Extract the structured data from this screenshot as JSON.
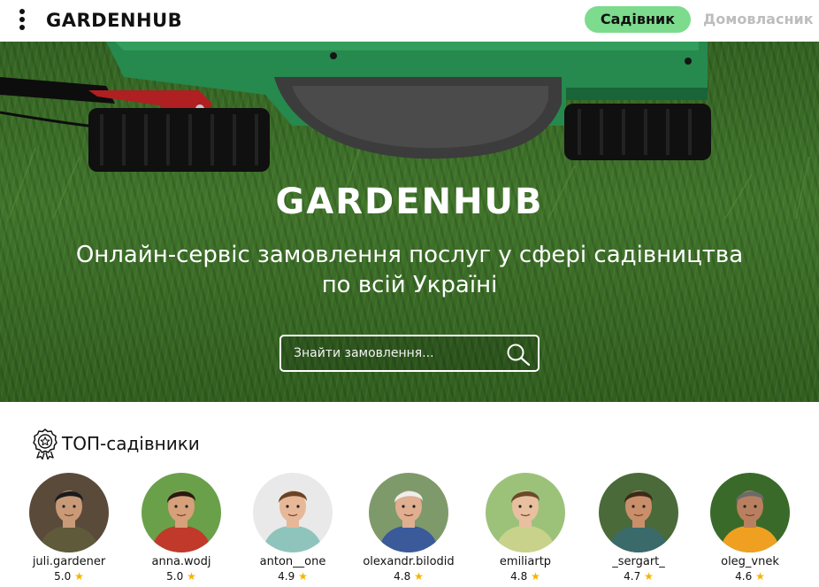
{
  "header": {
    "logo": "GARDENHUB",
    "role_active": "Садівник",
    "role_inactive": "Домовласник"
  },
  "hero": {
    "title": "GARDENHUB",
    "subtitle_line1": "Онлайн-сервіс замовлення послуг у сфері садівництва",
    "subtitle_line2": "по всій Україні",
    "search_placeholder": "Знайти замовлення..."
  },
  "top": {
    "title": "ТОП-садівники",
    "gardeners": [
      {
        "name": "juli.gardener",
        "rating": "5.0",
        "skin": "#c99a78",
        "hair": "#1b1b1b",
        "bg": "#5a4a3a",
        "shirt": "#5e5a3a"
      },
      {
        "name": "anna.wodj",
        "rating": "5.0",
        "skin": "#d6a07a",
        "hair": "#2a1a10",
        "bg": "#6aa04a",
        "shirt": "#c0392b"
      },
      {
        "name": "anton__one",
        "rating": "4.9",
        "skin": "#e6b898",
        "hair": "#6b4226",
        "bg": "#e9e9e9",
        "shirt": "#8fc4bd"
      },
      {
        "name": "olexandr.bilodid",
        "rating": "4.8",
        "skin": "#e0ae90",
        "hair": "#eeeeee",
        "bg": "#7f9a6a",
        "shirt": "#3b5a9a"
      },
      {
        "name": "emiliartp",
        "rating": "4.8",
        "skin": "#e8c0a0",
        "hair": "#6b4a2a",
        "bg": "#9cc27a",
        "shirt": "#c8d28a"
      },
      {
        "name": "_sergart_",
        "rating": "4.7",
        "skin": "#c98f6a",
        "hair": "#3a2a1a",
        "bg": "#4a6a3a",
        "shirt": "#3a6a6a"
      },
      {
        "name": "oleg_vnek",
        "rating": "4.6",
        "skin": "#b98060",
        "hair": "#6b6b6b",
        "bg": "#3a6a2a",
        "shirt": "#f0a020"
      }
    ]
  },
  "colors": {
    "accent": "#7ddb8e",
    "star": "#f5b400",
    "mower_green": "#2fa860"
  }
}
